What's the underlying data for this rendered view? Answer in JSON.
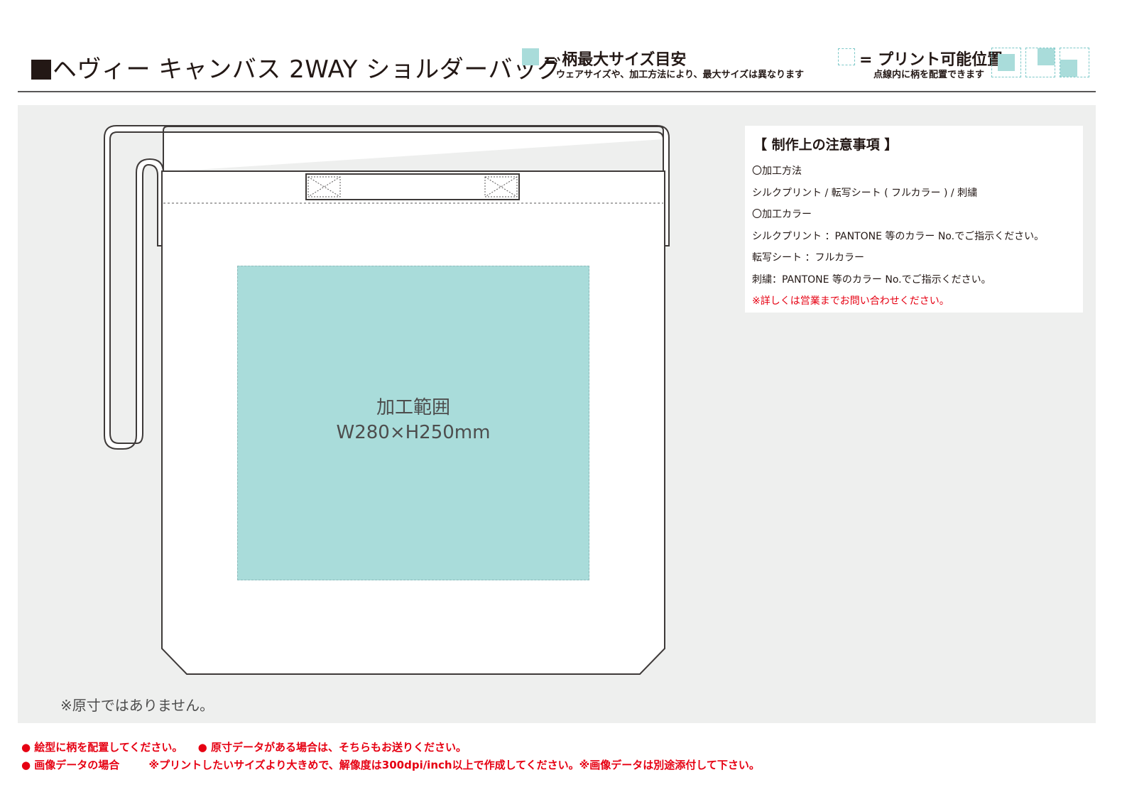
{
  "header": {
    "title": "ヘヴィー キャンバス 2WAY ショルダーバッグ",
    "legend_max": {
      "label": "= 柄最大サイズ目安",
      "note": "ウェアサイズや、加工方法により、最大サイズは異なります",
      "color": "#a9dcda"
    },
    "legend_print": {
      "label": "= プリント可能位置",
      "note": "点線内に柄を配置できます"
    }
  },
  "diagram": {
    "print_area": {
      "label": "加工範囲",
      "size": "W280×H250mm"
    },
    "disclaimer": "※原寸ではありません。"
  },
  "notes": {
    "heading": "【 制作上の注意事項 】",
    "lines": [
      "〇加工方法",
      "シルクプリント / 転写シート ( フルカラー ) / 刺繍",
      "〇加工カラー",
      "シルクプリント ：PANTONE 等のカラー No.でご指示ください。",
      "転写シート ：フルカラー",
      "刺繍：PANTONE 等のカラー No.でご指示ください。"
    ],
    "warning": "※詳しくは営業までお問い合わせください。"
  },
  "footer": {
    "item1": "● 絵型に柄を配置してください。",
    "item2": "● 原寸データがある場合は、そちらもお送りください。",
    "item3": "● 画像データの場合",
    "item4": "※プリントしたいサイズより大きめで、解像度は300dpi/inch以上で作成してください。※画像データは別途添付して下さい。"
  }
}
